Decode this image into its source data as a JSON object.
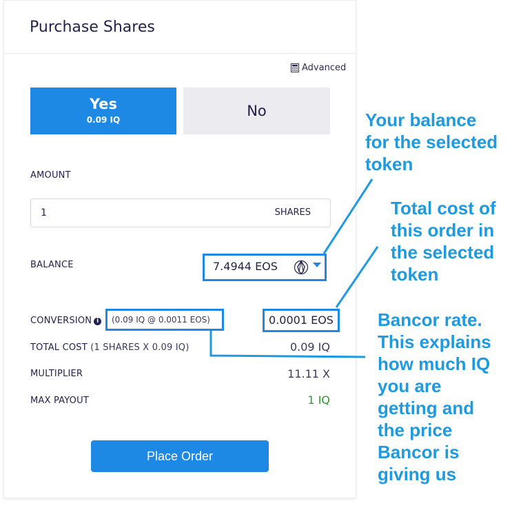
{
  "card": {
    "title": "Purchase Shares",
    "advanced_label": "Advanced",
    "advanced_icon": "calculator-icon"
  },
  "outcome": {
    "yes": {
      "label": "Yes",
      "price": "0.09 IQ"
    },
    "no": {
      "label": "No"
    },
    "selected": "yes",
    "accent_color": "#1e88e5"
  },
  "amount": {
    "label": "AMOUNT",
    "value": "1",
    "unit": "SHARES"
  },
  "balance": {
    "label": "BALANCE",
    "value": "7.4944 EOS",
    "token_icon": "eos-token-icon"
  },
  "conversion": {
    "label": "CONVERSION",
    "rate": "(0.09 IQ @ 0.0011 EOS)",
    "value": "0.0001 EOS"
  },
  "total_cost": {
    "label": "TOTAL COST",
    "detail": "(1 SHARES X 0.09 IQ)",
    "value": "0.09 IQ"
  },
  "multiplier": {
    "label": "MULTIPLIER",
    "value": "11.11 X"
  },
  "max_payout": {
    "label": "MAX PAYOUT",
    "value": "1 IQ",
    "color": "#2e9a2e"
  },
  "place_order_label": "Place Order",
  "annotations": {
    "balance_note": [
      "Your balance",
      "for the selected",
      "token"
    ],
    "cost_note": [
      "Total cost of",
      "this order in",
      "the selected",
      "token"
    ],
    "rate_note": [
      "Bancor rate.",
      "This explains",
      "how much IQ",
      "you are",
      "getting and",
      "the price",
      "Bancor is",
      "giving us"
    ],
    "color": "#1e9be0"
  }
}
